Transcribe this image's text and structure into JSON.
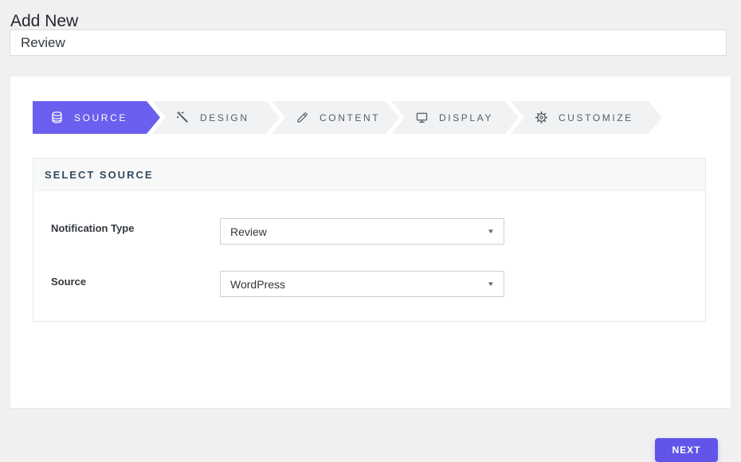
{
  "page_title": "Add New",
  "title_input": {
    "value": "Review"
  },
  "wizard": {
    "steps": [
      {
        "label": "SOURCE",
        "icon": "database-icon",
        "active": true
      },
      {
        "label": "DESIGN",
        "icon": "magic-wand-icon",
        "active": false
      },
      {
        "label": "CONTENT",
        "icon": "pencil-icon",
        "active": false
      },
      {
        "label": "DISPLAY",
        "icon": "monitor-icon",
        "active": false
      },
      {
        "label": "CUSTOMIZE",
        "icon": "gear-icon",
        "active": false
      }
    ]
  },
  "section": {
    "heading": "SELECT SOURCE",
    "fields": [
      {
        "label": "Notification Type",
        "value": "Review"
      },
      {
        "label": "Source",
        "value": "WordPress"
      }
    ]
  },
  "footer": {
    "next_label": "NEXT"
  },
  "colors": {
    "accent_tab": "#6a5fee",
    "button": "#6155e9",
    "page_background": "#f0f0f1",
    "inactive_tab_background": "#f1f2f3",
    "section_heading_text": "#334a5e"
  }
}
